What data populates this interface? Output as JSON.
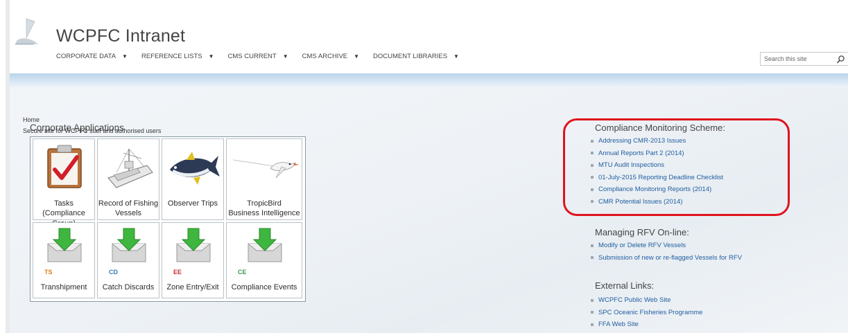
{
  "header": {
    "site_title": "WCPFC Intranet",
    "nav": [
      {
        "label": "CORPORATE DATA"
      },
      {
        "label": "REFERENCE LISTS"
      },
      {
        "label": "CMS CURRENT"
      },
      {
        "label": "CMS ARCHIVE"
      },
      {
        "label": "DOCUMENT LIBRARIES"
      }
    ],
    "search_placeholder": "Search this site",
    "search_icon": "search-icon"
  },
  "page": {
    "breadcrumb": "Home",
    "subtitle": "Secure site for WCPFC staff and authorised users",
    "section_title": "Corporate Applications"
  },
  "tiles": [
    {
      "label_line1": "Tasks",
      "label_line2": "(Compliance Group)",
      "icon": "clipboard-check-icon"
    },
    {
      "label_line1": "Record of Fishing",
      "label_line2": "Vessels",
      "icon": "fishing-vessel-icon"
    },
    {
      "label_line1": "Observer Trips",
      "label_line2": "",
      "icon": "tuna-fish-icon"
    },
    {
      "label_line1": "TropicBird",
      "label_line2": "Business Intelligence",
      "icon": "tropicbird-icon"
    },
    {
      "abbr": "TS",
      "abbr_color": "#e07c1a",
      "label_line1": "Transhipment",
      "icon": "inbox-download-icon"
    },
    {
      "abbr": "CD",
      "abbr_color": "#3a78b5",
      "label_line1": "Catch Discards",
      "icon": "inbox-download-icon"
    },
    {
      "abbr": "EE",
      "abbr_color": "#c4302b",
      "label_line1": "Zone Entry/Exit",
      "icon": "inbox-download-icon"
    },
    {
      "abbr": "CE",
      "abbr_color": "#3f9a4a",
      "label_line1": "Compliance Events",
      "icon": "inbox-download-icon"
    }
  ],
  "compliance": {
    "title": "Compliance Monitoring Scheme:",
    "links": [
      "Addressing CMR-2013 Issues",
      "Annual Reports Part 2 (2014)",
      "MTU Audit Inspections",
      "01-July-2015 Reporting Deadline Checklist",
      "Compliance Monitoring Reports (2014)",
      "CMR Potential Issues (2014)"
    ]
  },
  "rfv": {
    "title": "Managing RFV On-line:",
    "links": [
      "Modify or Delete RFV Vessels",
      "Submission of new or re-flagged Vessels for RFV"
    ]
  },
  "external": {
    "title": "External Links:",
    "links": [
      "WCPFC Public Web Site",
      "SPC Oceanic Fisheries Programme",
      "FFA Web Site"
    ]
  },
  "colors": {
    "link": "#1f5c9f",
    "highlight": "#e0121b",
    "download_arrow": "#3fb63f"
  }
}
